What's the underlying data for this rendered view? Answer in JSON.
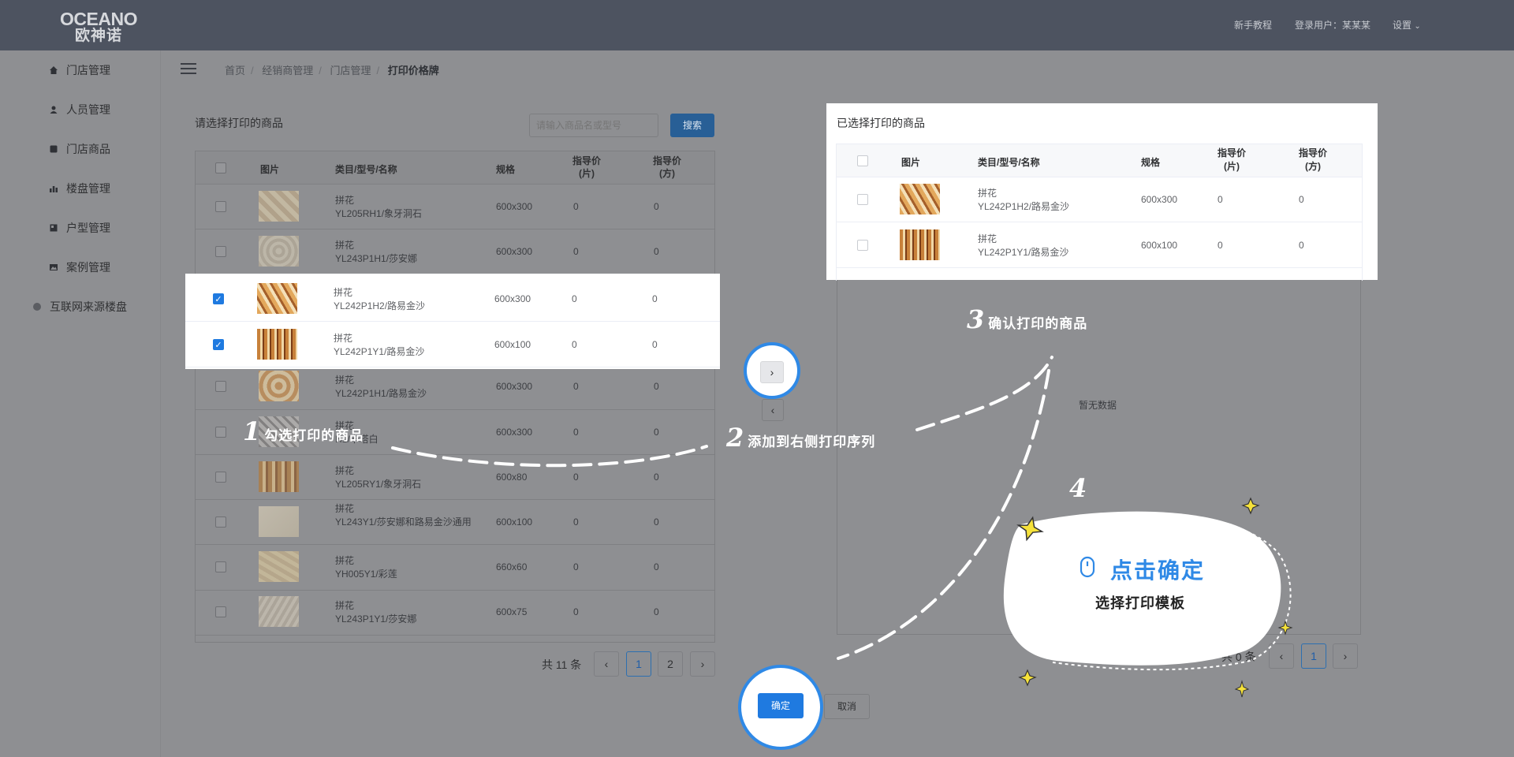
{
  "header": {
    "logo_en": "OCEANO",
    "logo_cn": "欧神诺",
    "links": [
      "新手教程",
      "登录用户：某某某",
      "设置"
    ]
  },
  "sidebar": {
    "items": [
      {
        "label": "门店管理",
        "icon": "home-icon"
      },
      {
        "label": "人员管理",
        "icon": "user-icon"
      },
      {
        "label": "门店商品",
        "icon": "product-icon"
      },
      {
        "label": "楼盘管理",
        "icon": "chart-icon"
      },
      {
        "label": "户型管理",
        "icon": "layout-icon"
      },
      {
        "label": "案例管理",
        "icon": "image-icon"
      },
      {
        "label": "互联网来源楼盘",
        "icon": "globe-icon"
      }
    ]
  },
  "breadcrumb": [
    "首页",
    "经销商管理",
    "门店管理",
    "打印价格牌"
  ],
  "left": {
    "title": "请选择打印的商品",
    "search_placeholder": "请输入商品名或型号",
    "search_button": "搜索",
    "headers": [
      "图片",
      "类目/型号/名称",
      "规格",
      "指导价\n(片)",
      "指导价\n(方)"
    ],
    "rows": [
      {
        "cat": "拼花",
        "name": "YL205RH1/象牙洞石",
        "spec": "600x300",
        "p1": "0",
        "p2": "0",
        "checked": false
      },
      {
        "cat": "拼花",
        "name": "YL243P1H1/莎安娜",
        "spec": "600x300",
        "p1": "0",
        "p2": "0",
        "checked": false
      },
      {
        "cat": "拼花",
        "name": "YL242P1H2/路易金沙",
        "spec": "600x300",
        "p1": "0",
        "p2": "0",
        "checked": true
      },
      {
        "cat": "拼花",
        "name": "YL242P1Y1/路易金沙",
        "spec": "600x100",
        "p1": "0",
        "p2": "0",
        "checked": true
      },
      {
        "cat": "拼花",
        "name": "YL242P1H1/路易金沙",
        "spec": "600x300",
        "p1": "0",
        "p2": "0",
        "checked": false
      },
      {
        "cat": "拼花",
        "name": "H1/卡塔白",
        "spec": "600x300",
        "p1": "0",
        "p2": "0",
        "checked": false
      },
      {
        "cat": "拼花",
        "name": "YL205RY1/象牙洞石",
        "spec": "600x80",
        "p1": "0",
        "p2": "0",
        "checked": false
      },
      {
        "cat": "拼花",
        "name": "YL243Y1/莎安娜和路易金沙通用",
        "spec": "600x100",
        "p1": "0",
        "p2": "0",
        "checked": false
      },
      {
        "cat": "拼花",
        "name": "YH005Y1/彩莲",
        "spec": "660x60",
        "p1": "0",
        "p2": "0",
        "checked": false
      },
      {
        "cat": "拼花",
        "name": "YL243P1Y1/莎安娜",
        "spec": "600x75",
        "p1": "0",
        "p2": "0",
        "checked": false
      }
    ],
    "total": "共 11 条",
    "pages": [
      "1",
      "2"
    ],
    "prev": "‹",
    "next": "›"
  },
  "right": {
    "title": "已选择打印的商品",
    "headers": [
      "图片",
      "类目/型号/名称",
      "规格",
      "指导价\n(片)",
      "指导价\n(方)"
    ],
    "rows": [
      {
        "cat": "拼花",
        "name": "YL242P1H2/路易金沙",
        "spec": "600x300",
        "p1": "0",
        "p2": "0"
      },
      {
        "cat": "拼花",
        "name": "YL242P1Y1/路易金沙",
        "spec": "600x100",
        "p1": "0",
        "p2": "0"
      }
    ],
    "empty": "暂无数据",
    "total": "共 0 条",
    "pages": [
      "1"
    ],
    "prev": "‹",
    "next": "›"
  },
  "transfer": {
    "to_right": "›",
    "to_left": "‹"
  },
  "footer": {
    "confirm": "确定",
    "cancel": "取消"
  },
  "annotations": {
    "step1_num": "1",
    "step1": "勾选打印的商品",
    "step2_num": "2",
    "step2": "添加到右侧打印序列",
    "step3_num": "3",
    "step3": "确认打印的商品",
    "step4_num": "4",
    "step4_title": "点击确定",
    "step4_sub": "选择打印模板"
  },
  "colors": {
    "header": "#4d5360",
    "overlay": "#8e8f92",
    "accent": "#1f7ae0",
    "ring": "#2f89e6",
    "spark": "#f6e23a"
  }
}
